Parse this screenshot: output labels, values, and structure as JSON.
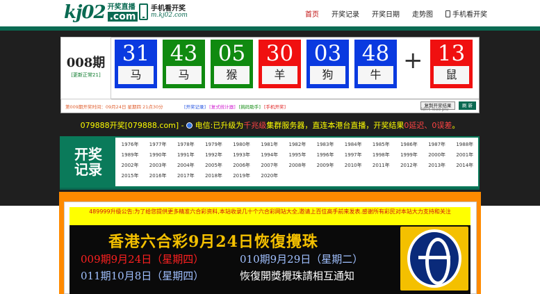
{
  "header": {
    "logo_main": "kj02",
    "logo_cn": "开奖直播",
    "logo_com": ".com",
    "mobile_title": "手机看开奖",
    "mobile_url": "m.kj02.com",
    "nav": [
      "首页",
      "开奖记录",
      "开奖日期",
      "走势图",
      "手机看开奖"
    ]
  },
  "draw": {
    "period": "008期",
    "period_sub": "[更新正常21]",
    "balls": [
      {
        "num": "31",
        "zodiac": "马",
        "color": "blue"
      },
      {
        "num": "43",
        "zodiac": "马",
        "color": "green"
      },
      {
        "num": "05",
        "zodiac": "猴",
        "color": "green"
      },
      {
        "num": "30",
        "zodiac": "羊",
        "color": "red"
      },
      {
        "num": "03",
        "zodiac": "狗",
        "color": "blue"
      },
      {
        "num": "48",
        "zodiac": "牛",
        "color": "blue"
      }
    ],
    "plus": "+",
    "special": {
      "num": "13",
      "zodiac": "鼠",
      "color": "red"
    },
    "next_info": "第009期开奖时间：09月24日 星期四 21点30分",
    "links": [
      {
        "label": "[开奖记录]",
        "color": "#2050e0"
      },
      {
        "label": "[复式统计器]",
        "color": "#d020d0"
      },
      {
        "label": "[挑码助手]",
        "color": "#108a10"
      },
      {
        "label": "[手机开奖]",
        "color": "#e02020"
      }
    ],
    "copy_button": "复制开奖结果",
    "copy_overlay": "ldn't load plu",
    "refresh_button": "刷 新"
  },
  "ticker": {
    "part1": "079888开奖[079888.com]  -",
    "part2": "电信:已升级为",
    "part3": "千兆级",
    "part4": "集群服务器，直连本港台直播，开奖结果",
    "part5": "0延迟、0误差",
    "part6": "。"
  },
  "records": {
    "title1": "开奖",
    "title2": "记录",
    "years": [
      "1976年",
      "1977年",
      "1978年",
      "1979年",
      "1980年",
      "1981年",
      "1982年",
      "1983年",
      "1984年",
      "1985年",
      "1986年",
      "1987年",
      "1988年",
      "1989年",
      "1990年",
      "1991年",
      "1992年",
      "1993年",
      "1994年",
      "1995年",
      "1996年",
      "1997年",
      "1998年",
      "1999年",
      "2000年",
      "2001年",
      "2002年",
      "2003年",
      "2004年",
      "2005年",
      "2006年",
      "2007年",
      "2008年",
      "2009年",
      "2010年",
      "2011年",
      "2012年",
      "2013年",
      "2014年",
      "2015年",
      "2016年",
      "2017年",
      "2018年",
      "2019年",
      "2020年"
    ]
  },
  "notice": "489999升级公告:为了给您提供更多精准六合彩资料,本站收录几十个六合彩网站大全,邀请上百位高手前来发表.感谢所有彩民对本站大力支持和关注",
  "banner": {
    "title": "香港六合彩9月24日恢復攪珠",
    "row1a": "009期9月24日（星期四）",
    "row1b": "010期9月29日（星期二）",
    "row2a": "011期10月8日（星期四）",
    "row2b": "恢復開獎攪珠請相互通知"
  },
  "colors": {
    "brand": "#0a6a52",
    "ball_red": "#f01010",
    "ball_blue": "#0a3ae0",
    "ball_green": "#108a10",
    "frame": "#ff8a00"
  }
}
